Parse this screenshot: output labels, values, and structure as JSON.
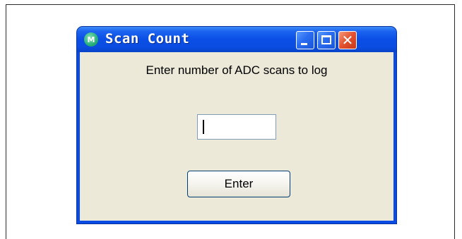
{
  "window": {
    "title": "Scan Count",
    "app_icon_letter": "M",
    "controls": {
      "minimize": "minimize",
      "maximize": "maximize",
      "close": "✕"
    }
  },
  "dialog": {
    "prompt": "Enter number of ADC scans to log",
    "input_value": "",
    "enter_label": "Enter"
  },
  "colors": {
    "titlebar": "#0a4ce3",
    "client": "#ece9d8",
    "close_button": "#e2502e"
  }
}
